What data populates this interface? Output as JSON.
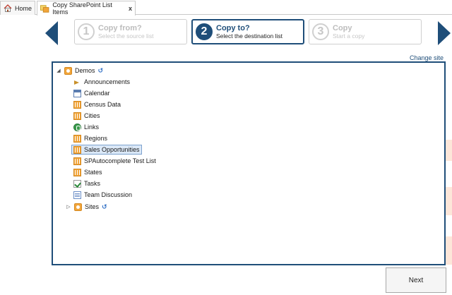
{
  "tabs": [
    {
      "label": "Home",
      "icon": "home-icon"
    },
    {
      "label": "Copy SharePoint List Items",
      "icon": "copy-list-icon",
      "close": "x"
    }
  ],
  "wizard": {
    "steps": [
      {
        "number": "1",
        "title": "Copy from?",
        "subtitle": "Select the source list",
        "state": "inactive"
      },
      {
        "number": "2",
        "title": "Copy to?",
        "subtitle": "Select the destination list",
        "state": "active"
      },
      {
        "number": "3",
        "title": "Copy",
        "subtitle": "Start a copy",
        "state": "inactive"
      }
    ]
  },
  "change_site": "Change site",
  "tree": {
    "root": {
      "label": "Demos",
      "expander": "◢",
      "icon": "site-icon"
    },
    "items": [
      {
        "label": "Announcements",
        "icon": "announcements-icon"
      },
      {
        "label": "Calendar",
        "icon": "calendar-icon"
      },
      {
        "label": "Census Data",
        "icon": "list-icon"
      },
      {
        "label": "Cities",
        "icon": "list-icon"
      },
      {
        "label": "Links",
        "icon": "links-icon"
      },
      {
        "label": "Regions",
        "icon": "list-icon"
      },
      {
        "label": "Sales Opportunities",
        "icon": "list-icon",
        "selected": true
      },
      {
        "label": "SPAutocomplete Test List",
        "icon": "list-icon"
      },
      {
        "label": "States",
        "icon": "list-icon"
      },
      {
        "label": "Tasks",
        "icon": "tasks-icon"
      },
      {
        "label": "Team Discussion",
        "icon": "discussion-icon"
      }
    ],
    "sites": {
      "label": "Sites",
      "expander": "▷",
      "icon": "site-icon"
    },
    "sync_glyph": "↺"
  },
  "buttons": {
    "next": "Next"
  },
  "colors": {
    "accent": "#1f4e79",
    "selected_bg": "#dbe8f7",
    "list_icon": "#f2a53a"
  }
}
